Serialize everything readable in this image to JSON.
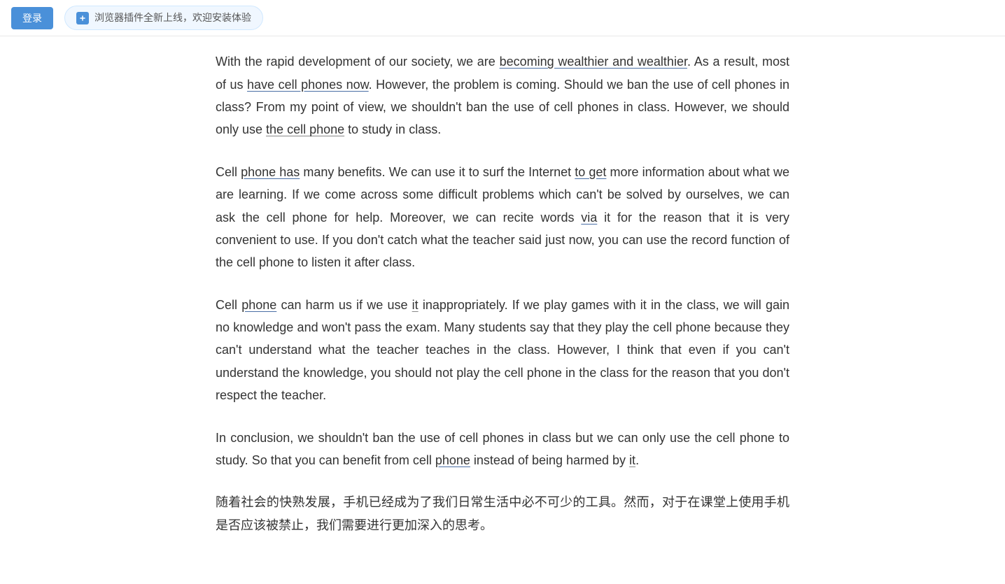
{
  "topbar": {
    "login_label": "登录",
    "plugin_notice": "浏览器插件全新上线，欢迎安装体验"
  },
  "content": {
    "paragraphs": [
      {
        "id": "p1",
        "text_parts": [
          {
            "text": "With the rapid development of our society, we are ",
            "style": "normal"
          },
          {
            "text": "becoming wealthier and wealthier",
            "style": "underline-blue"
          },
          {
            "text": ". As a result, most of us ",
            "style": "normal"
          },
          {
            "text": "have cell phones now",
            "style": "underline-blue"
          },
          {
            "text": ". However, the problem is coming. Should we ban the use of cell phones in class? From my point of view, we shouldn’t ban the use of cell phones in class. However, we should only use ",
            "style": "normal"
          },
          {
            "text": "the cell phone",
            "style": "underline-gray"
          },
          {
            "text": " to study in class.",
            "style": "normal"
          }
        ]
      },
      {
        "id": "p2",
        "text_parts": [
          {
            "text": "Cell ",
            "style": "normal"
          },
          {
            "text": "phone has",
            "style": "underline-blue"
          },
          {
            "text": " many benefits. We can use it to surf the Internet ",
            "style": "normal"
          },
          {
            "text": "to get",
            "style": "underline-blue"
          },
          {
            "text": " more information about what we are learning. If we come across some difficult problems which can’t be solved by ourselves, we can ask the cell phone for help. Moreover, we can recite words ",
            "style": "normal"
          },
          {
            "text": "via",
            "style": "underline-blue"
          },
          {
            "text": " it for the reason that it is very convenient to use. If you don’t catch what the teacher said just now, you can use the record function of the cell phone to listen it after class.",
            "style": "normal"
          }
        ]
      },
      {
        "id": "p3",
        "text_parts": [
          {
            "text": "Cell ",
            "style": "normal"
          },
          {
            "text": "phone",
            "style": "underline-blue"
          },
          {
            "text": " can harm us if we use ",
            "style": "normal"
          },
          {
            "text": "it",
            "style": "underline-gray"
          },
          {
            "text": " inappropriately. If we play games with it in the class, we will gain no knowledge and won’t pass the exam. Many students say that they play the cell phone because they can’t understand what the teacher teaches in the class. However, I think that even if you can’t understand the knowledge, you should not play the cell phone in the class for the reason that you don’t respect the teacher.",
            "style": "normal"
          }
        ]
      },
      {
        "id": "p4",
        "text_parts": [
          {
            "text": "In conclusion, we shouldn’t ban the use of cell phones in class but we can only use the cell phone to study. So that you can benefit from cell ",
            "style": "normal"
          },
          {
            "text": "phone",
            "style": "underline-blue"
          },
          {
            "text": " instead of being harmed by ",
            "style": "normal"
          },
          {
            "text": "it",
            "style": "underline-gray"
          },
          {
            "text": ".",
            "style": "normal"
          }
        ]
      },
      {
        "id": "p5",
        "text_parts": [
          {
            "text": "随着社会的快熟发展，手机已经成为了我们日常生活中必不可少的工具。然而，对于在课堂上使用手机是否应该被禁止，我们需要进行更加深入的思考。",
            "style": "chinese-text"
          }
        ]
      }
    ]
  }
}
